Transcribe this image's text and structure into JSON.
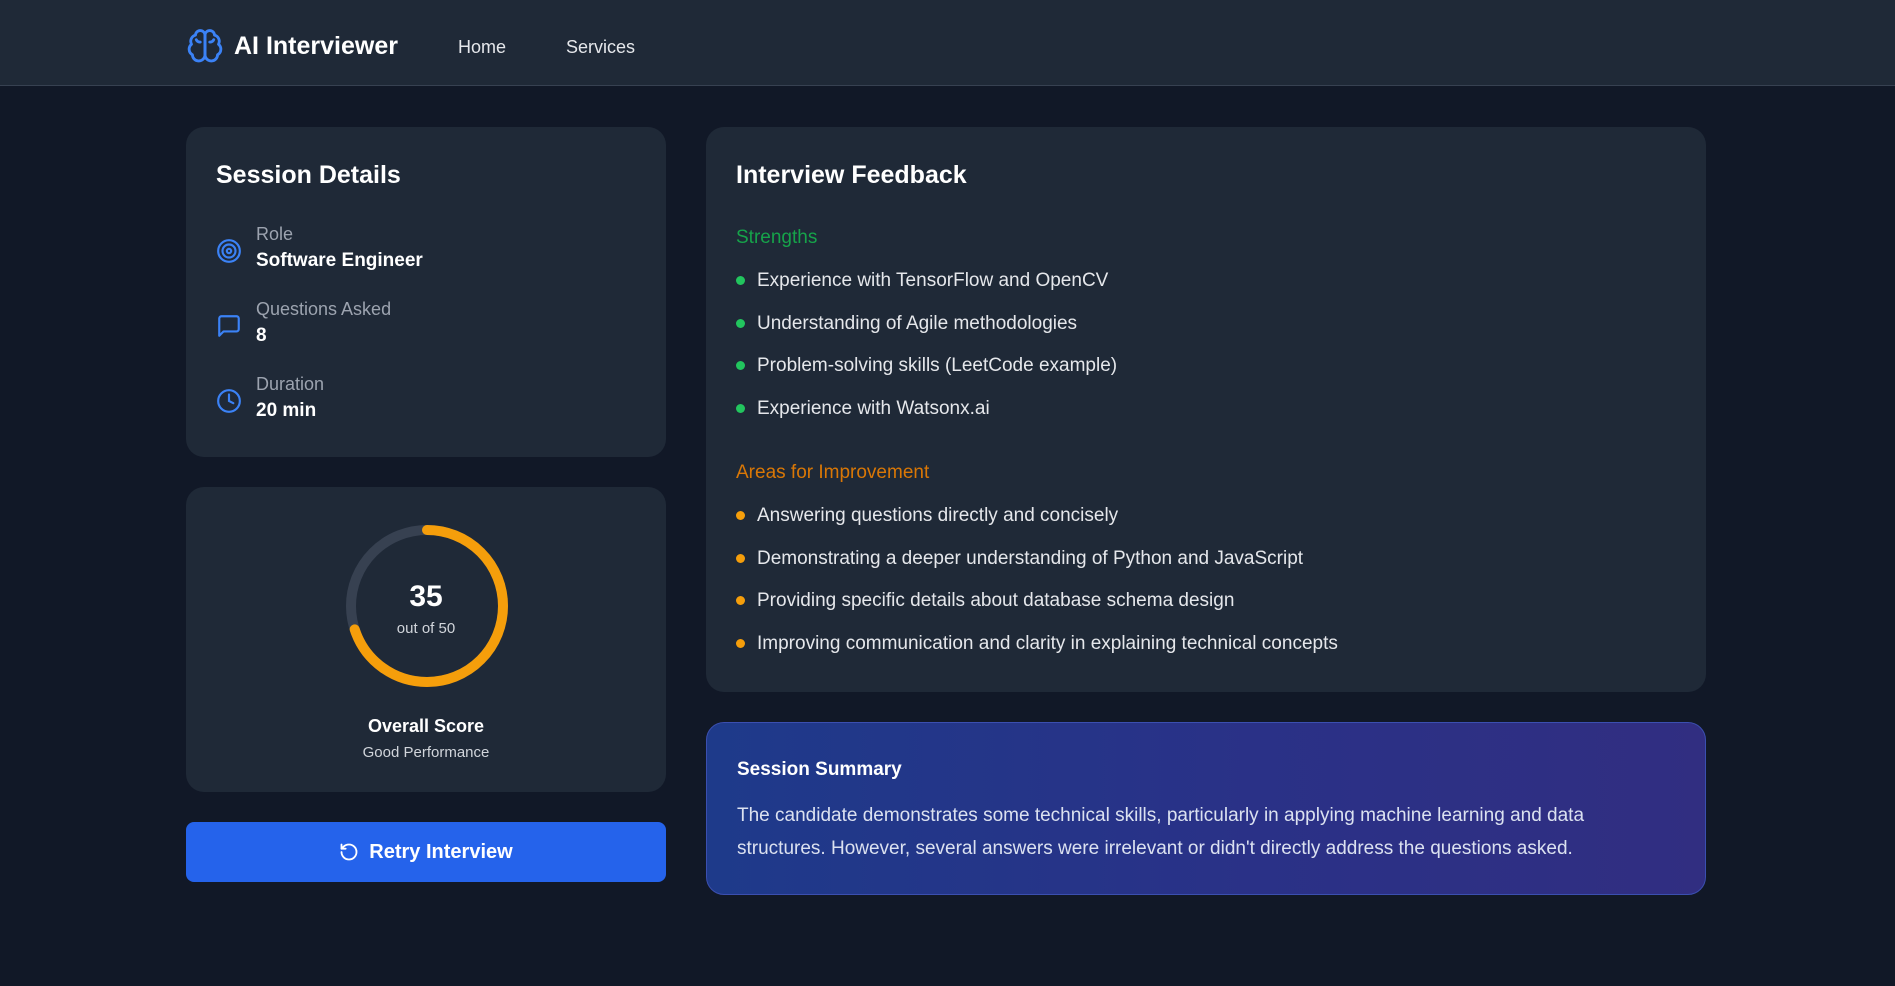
{
  "app": {
    "name": "AI Interviewer",
    "brand_icon": "brain-icon"
  },
  "nav": {
    "home": "Home",
    "services": "Services"
  },
  "session": {
    "title": "Session Details",
    "details": [
      {
        "icon": "target-icon",
        "label": "Role",
        "value": "Software Engineer"
      },
      {
        "icon": "message-icon",
        "label": "Questions Asked",
        "value": "8"
      },
      {
        "icon": "clock-icon",
        "label": "Duration",
        "value": "20 min"
      }
    ]
  },
  "score": {
    "value": "35",
    "out_of": "out of 50",
    "fraction": 0.7,
    "title": "Overall Score",
    "description": "Good Performance",
    "ring_color": "#f59e0b",
    "track_color": "#374151"
  },
  "retry": {
    "label": "Retry Interview",
    "icon": "refresh-icon"
  },
  "feedback": {
    "title": "Interview Feedback",
    "strengths_title": "Strengths",
    "strengths": [
      "Experience with TensorFlow and OpenCV",
      "Understanding of Agile methodologies",
      "Problem-solving skills (LeetCode example)",
      "Experience with Watsonx.ai"
    ],
    "improvements_title": "Areas for Improvement",
    "improvements": [
      "Answering questions directly and concisely",
      "Demonstrating a deeper understanding of Python and JavaScript",
      "Providing specific details about database schema design",
      "Improving communication and clarity in explaining technical concepts"
    ]
  },
  "summary": {
    "title": "Session Summary",
    "text": "The candidate demonstrates some technical skills, particularly in applying machine learning and data structures. However, several answers were irrelevant or didn't directly address the questions asked."
  },
  "colors": {
    "accent": "#2563eb",
    "strength": "#22c55e",
    "improvement": "#f59e0b",
    "background": "#111827",
    "card": "#1f2937"
  }
}
